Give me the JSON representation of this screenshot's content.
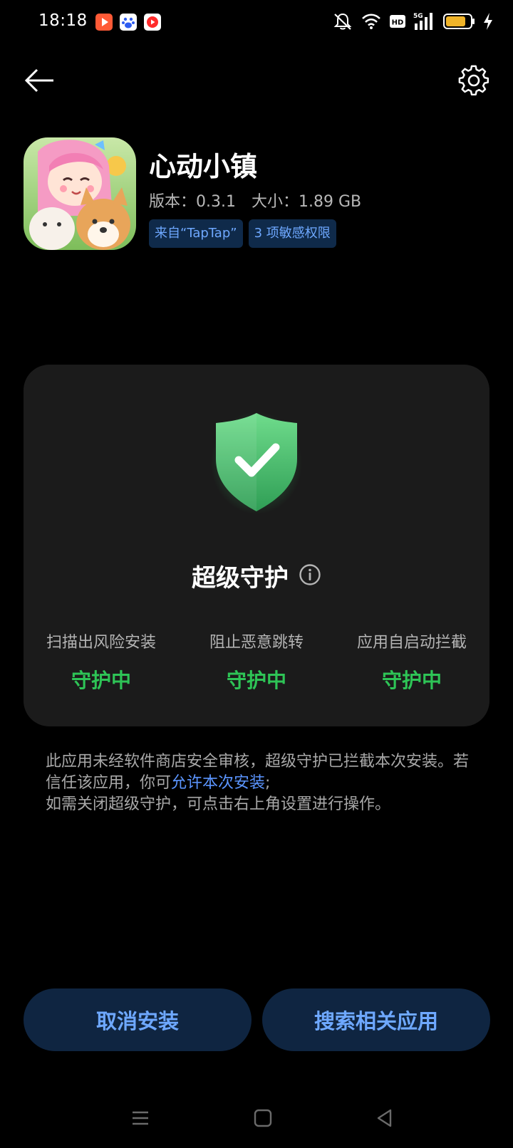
{
  "status_bar": {
    "time": "18:18",
    "notification_icons": [
      "video-app-icon",
      "baidu-app-icon",
      "record-app-icon"
    ],
    "status_icons": [
      "mute-icon",
      "wifi-icon",
      "hd-icon",
      "signal-5g-icon",
      "battery-icon",
      "charging-icon"
    ],
    "network_label": "5G",
    "hd_label": "HD"
  },
  "top_bar": {
    "back_icon": "back-arrow-icon",
    "settings_icon": "gear-icon"
  },
  "app": {
    "name": "心动小镇",
    "version": "版本：0.3.1",
    "size": "大小：1.89 GB",
    "source_tag": "来自“TapTap”",
    "permissions_tag": "3 项敏感权限"
  },
  "protection": {
    "title": "超级守护",
    "info_icon": "info-icon",
    "features": [
      {
        "label": "扫描出风险安装",
        "status": "守护中"
      },
      {
        "label": "阻止恶意跳转",
        "status": "守护中"
      },
      {
        "label": "应用自启动拦截",
        "status": "守护中"
      }
    ]
  },
  "notice": {
    "text_part1": "此应用未经软件商店安全审核，超级守护已拦截本次安装。若信任该应用，你可",
    "link": "允许本次安装",
    "text_part2": ";",
    "text_line3": "如需关闭超级守护，可点击右上角设置进行操作。"
  },
  "buttons": {
    "cancel": "取消安装",
    "search": "搜索相关应用"
  },
  "nav_bar": {
    "items": [
      "menu-icon",
      "home-icon",
      "back-triangle-icon"
    ]
  },
  "colors": {
    "background": "#000000",
    "card": "#1b1b1b",
    "accent_blue": "#6ea8ff",
    "link_blue": "#5b95ff",
    "status_green": "#2ec456",
    "button_bg": "#0f2541"
  }
}
